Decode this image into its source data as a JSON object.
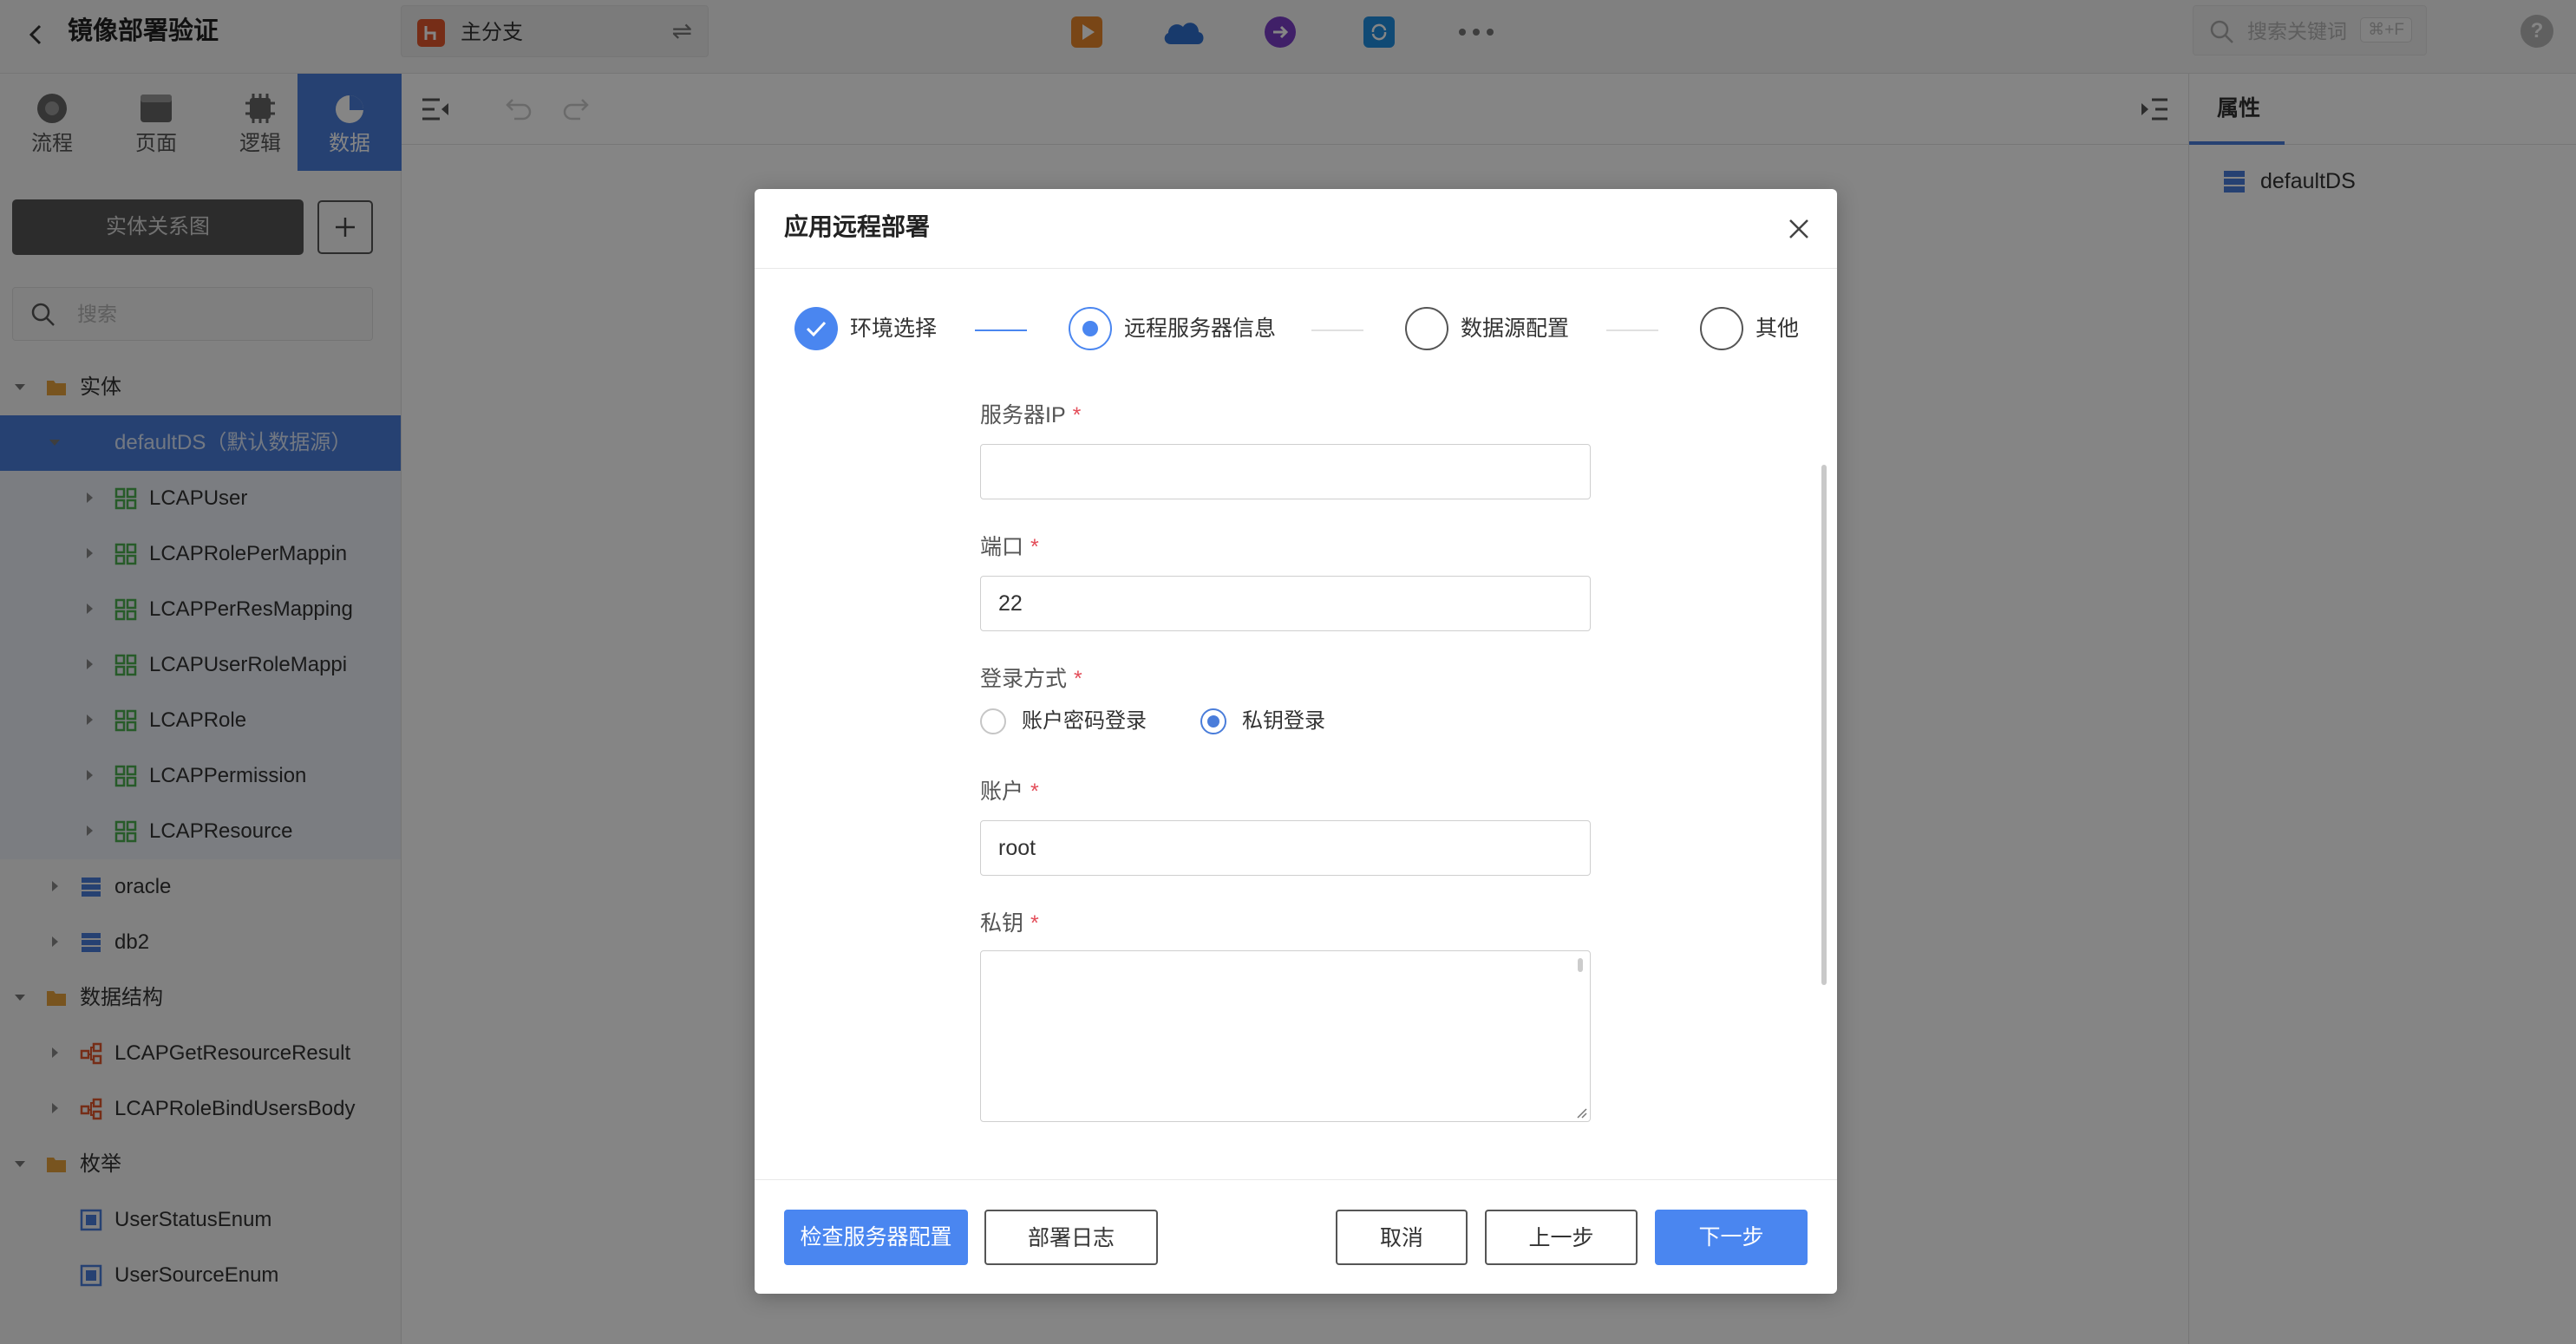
{
  "topbar": {
    "title": "镜像部署验证",
    "branch": "主分支",
    "search_placeholder": "搜索关键词",
    "search_shortcut": "⌘+F",
    "help": "?"
  },
  "sidebar": {
    "tabs": [
      {
        "label": "流程",
        "icon": "flow-icon"
      },
      {
        "label": "页面",
        "icon": "page-icon"
      },
      {
        "label": "逻辑",
        "icon": "logic-icon"
      },
      {
        "label": "数据",
        "icon": "data-icon",
        "active": true
      }
    ],
    "er_button": "实体关系图",
    "search_placeholder": "搜索",
    "tree": [
      {
        "label": "实体",
        "type": "folder"
      },
      {
        "label": "defaultDS（默认数据源）",
        "type": "datasource",
        "selected": true
      },
      {
        "label": "LCAPUser",
        "type": "entity"
      },
      {
        "label": "LCAPRolePerMappin",
        "type": "entity"
      },
      {
        "label": "LCAPPerResMapping",
        "type": "entity"
      },
      {
        "label": "LCAPUserRoleMappi",
        "type": "entity"
      },
      {
        "label": "LCAPRole",
        "type": "entity"
      },
      {
        "label": "LCAPPermission",
        "type": "entity"
      },
      {
        "label": "LCAPResource",
        "type": "entity"
      },
      {
        "label": "oracle",
        "type": "datasource"
      },
      {
        "label": "db2",
        "type": "datasource"
      },
      {
        "label": "数据结构",
        "type": "folder"
      },
      {
        "label": "LCAPGetResourceResult",
        "type": "structure"
      },
      {
        "label": "LCAPRoleBindUsersBody",
        "type": "structure"
      },
      {
        "label": "枚举",
        "type": "folder"
      },
      {
        "label": "UserStatusEnum",
        "type": "enum"
      },
      {
        "label": "UserSourceEnum",
        "type": "enum"
      }
    ]
  },
  "right_panel": {
    "tab": "属性",
    "item": "defaultDS"
  },
  "modal": {
    "title": "应用远程部署",
    "steps": [
      {
        "label": "环境选择",
        "status": "done"
      },
      {
        "label": "远程服务器信息",
        "status": "current"
      },
      {
        "label": "数据源配置",
        "status": "pending"
      },
      {
        "label": "其他",
        "status": "pending"
      }
    ],
    "fields": {
      "server_ip": {
        "label": "服务器IP",
        "value": ""
      },
      "port": {
        "label": "端口",
        "value": "22"
      },
      "login_method": {
        "label": "登录方式",
        "options": [
          "账户密码登录",
          "私钥登录"
        ],
        "selected": "私钥登录"
      },
      "account": {
        "label": "账户",
        "value": "root"
      },
      "private_key": {
        "label": "私钥",
        "value": ""
      }
    },
    "required_mark": "*",
    "buttons": {
      "check": "检查服务器配置",
      "log": "部署日志",
      "cancel": "取消",
      "prev": "上一步",
      "next": "下一步"
    }
  },
  "colors": {
    "accent": "#4a7dda",
    "primary_button": "#4a86f0",
    "required": "#e34d59",
    "entity_icon": "#4caf50",
    "folder_icon": "#e6a23c",
    "structure_icon": "#e2572c"
  }
}
